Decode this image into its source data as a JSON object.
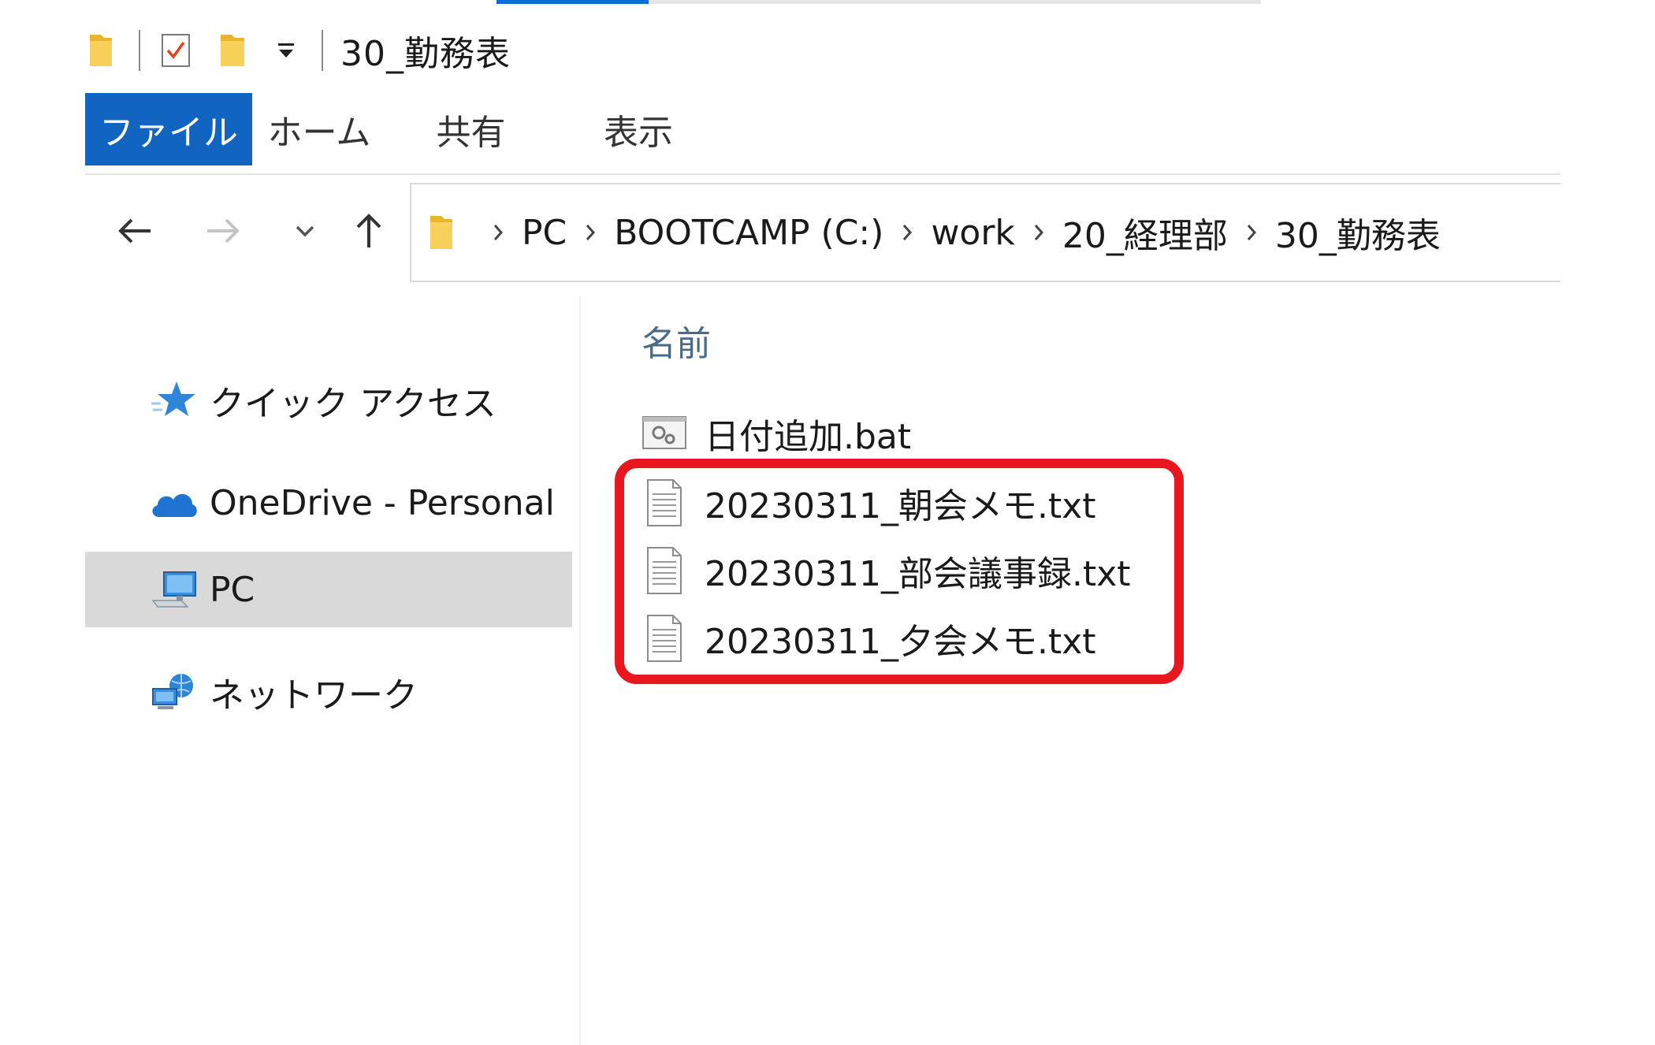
{
  "window": {
    "title": "30_勤務表"
  },
  "ribbon": {
    "tabs": [
      {
        "label": "ファイル",
        "active": true
      },
      {
        "label": "ホーム"
      },
      {
        "label": "共有"
      },
      {
        "label": "表示"
      }
    ]
  },
  "nav": {
    "back_icon": "arrow-left-icon",
    "forward_icon": "arrow-right-icon",
    "recent_icon": "chevron-down-icon",
    "up_icon": "arrow-up-icon"
  },
  "address": {
    "crumbs": [
      "PC",
      "BOOTCAMP (C:)",
      "work",
      "20_経理部",
      "30_勤務表"
    ]
  },
  "sidebar": {
    "items": [
      {
        "label": "クイック アクセス",
        "icon": "star-icon"
      },
      {
        "label": "OneDrive - Personal",
        "icon": "cloud-icon"
      },
      {
        "label": "PC",
        "icon": "computer-icon",
        "selected": true
      },
      {
        "label": "ネットワーク",
        "icon": "network-icon"
      }
    ]
  },
  "filelist": {
    "column_name": "名前",
    "files": [
      {
        "name": "日付追加.bat",
        "icon": "batch-file-icon"
      },
      {
        "name": "20230311_朝会メモ.txt",
        "icon": "text-file-icon"
      },
      {
        "name": "20230311_部会議事録.txt",
        "icon": "text-file-icon"
      },
      {
        "name": "20230311_夕会メモ.txt",
        "icon": "text-file-icon"
      }
    ]
  },
  "colors": {
    "accent": "#1165c1",
    "highlight": "#e8161e",
    "selected_bg": "#d9d9d9",
    "folder": "#f5c842"
  }
}
